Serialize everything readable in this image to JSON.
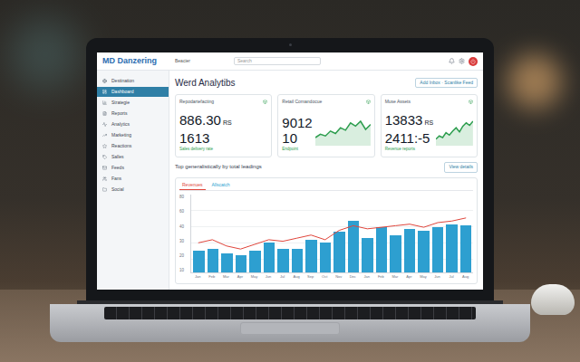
{
  "topbar": {
    "logo": "MD Danzering",
    "nav_label": "Beacier",
    "search": {
      "placeholder": "Search"
    }
  },
  "sidebar": {
    "items": [
      {
        "label": "Destination",
        "selected": false
      },
      {
        "label": "Dashboard",
        "selected": true
      },
      {
        "label": "Strategie",
        "selected": false
      },
      {
        "label": "Reports",
        "selected": false
      },
      {
        "label": "Analytics",
        "selected": false
      },
      {
        "label": "Marketing",
        "selected": false
      },
      {
        "label": "Reactions",
        "selected": false
      },
      {
        "label": "Salles",
        "selected": false
      },
      {
        "label": "Feeds",
        "selected": false
      },
      {
        "label": "Fans",
        "selected": false
      },
      {
        "label": "Social",
        "selected": false
      }
    ]
  },
  "page": {
    "title": "Werd Analytibs",
    "action": "Add Inbox · Scanlike Feed"
  },
  "cards": [
    {
      "title": "Repodartefacting",
      "value": "886.30",
      "unit": "RS",
      "secondary": "1613",
      "caption": "Sales delivery rate",
      "kind": "plain",
      "series": []
    },
    {
      "title": "Retail Comandocue",
      "value": "9012",
      "unit": "",
      "secondary": "10",
      "caption": "Endpoint",
      "kind": "chart",
      "series": [
        10,
        14,
        12,
        18,
        15,
        22,
        19,
        28,
        24,
        30,
        20,
        26
      ]
    },
    {
      "title": "Muse Assets",
      "value": "13833",
      "unit": "RS",
      "secondary": "2411:-5",
      "caption": "Revenue reports",
      "kind": "chart",
      "series": [
        8,
        12,
        10,
        16,
        13,
        18,
        22,
        17,
        24,
        28,
        25,
        30
      ]
    }
  ],
  "chart": {
    "title": "Top generalistically by total leadings",
    "action": "View details",
    "tabs": [
      {
        "label": "Revenues",
        "selected": true,
        "color": "#e0463c"
      },
      {
        "label": "Allscatch",
        "selected": false,
        "color": "#2d9fd0"
      }
    ],
    "y_ticks": [
      "80",
      "60",
      "40",
      "30",
      "20",
      "10"
    ],
    "x_labels": [
      "Jan",
      "Feb",
      "Mar",
      "Apr",
      "May",
      "Jun",
      "Jul",
      "Aug",
      "Sep",
      "Oct",
      "Nov",
      "Dec",
      "Jan",
      "Feb",
      "Mar",
      "Apr",
      "May",
      "Jun",
      "Jul",
      "Aug"
    ],
    "series": [
      {
        "name": "Allscatch",
        "color": "#2d9fd0",
        "values": [
          28,
          30,
          24,
          22,
          28,
          38,
          30,
          30,
          42,
          38,
          52,
          66,
          44,
          58,
          48,
          56,
          54,
          58,
          62,
          60
        ]
      },
      {
        "name": "Revenues",
        "color": "#e0463c",
        "values": [
          38,
          42,
          34,
          30,
          36,
          42,
          40,
          44,
          48,
          42,
          54,
          60,
          56,
          58,
          60,
          62,
          58,
          64,
          66,
          70
        ]
      }
    ]
  }
}
